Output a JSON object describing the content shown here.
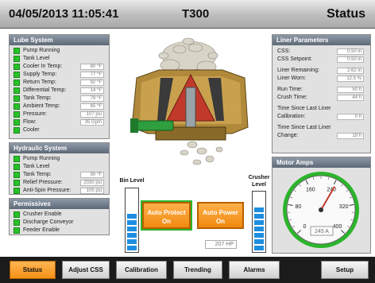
{
  "header": {
    "datetime": "04/05/2013 11:05:41",
    "title": "T300",
    "screen": "Status"
  },
  "lube": {
    "title": "Lube System",
    "rows": [
      {
        "label": "Pump Running",
        "led": true
      },
      {
        "label": "Tank Level",
        "led": true
      },
      {
        "label": "Cooler In Temp:",
        "led": true,
        "value": "80 °F"
      },
      {
        "label": "Supply Temp:",
        "led": true,
        "value": "77 °F"
      },
      {
        "label": "Return Temp:",
        "led": true,
        "value": "92 °F"
      },
      {
        "label": "Differential Temp:",
        "led": true,
        "value": "14 °F"
      },
      {
        "label": "Tank Temp:",
        "led": true,
        "value": "79 °F"
      },
      {
        "label": "Ambient Temp:",
        "led": true,
        "value": "65 °F"
      },
      {
        "label": "Pressure:",
        "led": true,
        "value": "107 psi"
      },
      {
        "label": "Flow:",
        "led": true,
        "value": "35 Gpm"
      },
      {
        "label": "Cooler",
        "led": true
      }
    ]
  },
  "hydraulic": {
    "title": "Hydraulic System",
    "rows": [
      {
        "label": "Pump Running",
        "led": true
      },
      {
        "label": "Tank Level",
        "led": true
      },
      {
        "label": "Tank Temp:",
        "led": true,
        "value": "90 °F"
      },
      {
        "label": "Relief Pressure:",
        "led": true,
        "value": "2030 psi"
      },
      {
        "label": "Anti-Spin Pressure:",
        "led": true,
        "value": "105 psi"
      }
    ]
  },
  "permissives": {
    "title": "Permissives",
    "rows": [
      {
        "label": "Crusher Enable",
        "led": true
      },
      {
        "label": "Discharge Conveyor",
        "led": true
      },
      {
        "label": "Feeder Enable",
        "led": true
      }
    ]
  },
  "liner": {
    "title": "Liner Parameters",
    "css_label": "CSS:",
    "css_value": "0.50 in",
    "setpoint_label": "CSS Setpoint:",
    "setpoint_value": "0.50 in",
    "remaining_label": "Liner Remaining:",
    "remaining_value": "2.62 in",
    "worn_label": "Liner Worn:",
    "worn_value": "12.5 %",
    "run_label": "Run Time:",
    "run_value": "50 h",
    "crush_label": "Crush Time:",
    "crush_value": "44 h",
    "cal_label1": "Time Since Last Liner",
    "cal_label2": "Calibration:",
    "cal_value": "0 h",
    "chg_label1": "Time Since Last Liner",
    "chg_label2": "Change:",
    "chg_value": "19 h"
  },
  "motor": {
    "title": "Motor Amps",
    "ticks": [
      "0",
      "80",
      "160",
      "240",
      "320",
      "400"
    ],
    "reading": "245 A",
    "amps": 245,
    "max": 400
  },
  "center": {
    "bin_level_label": "Bin Level",
    "crusher_level_label": "Crusher Level",
    "bin_level_fill": 0.62,
    "crusher_level_fill": 0.75,
    "auto_protect_label": "Auto Protect On",
    "auto_power_label": "Auto Power On",
    "power_value": "207 HP"
  },
  "tabs": [
    "Status",
    "Adjust CSS",
    "Calibration",
    "Trending",
    "Alarms",
    "Setup"
  ],
  "colors": {
    "accent": "#f39016",
    "led_on": "#27c227",
    "level": "#1e8fe0",
    "gauge_ring": "#2bb52b"
  }
}
